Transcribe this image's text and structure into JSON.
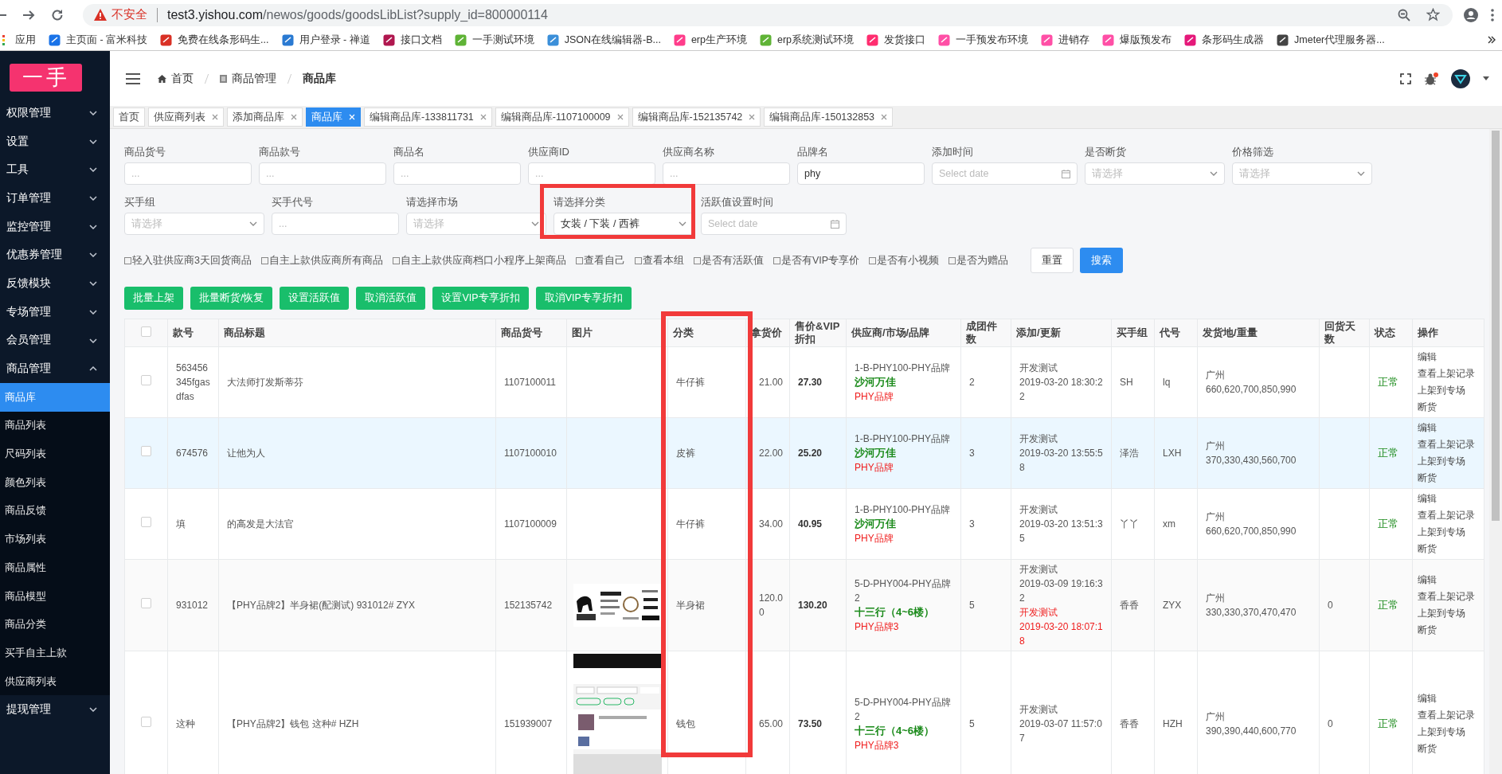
{
  "browser": {
    "security": "不安全",
    "url_host": "test3.yishou.com",
    "url_path": "/newos/goods/goodsLibList?supply_id=800000114"
  },
  "bookmarks": [
    {
      "label": "应用"
    },
    {
      "label": "主页面 - 富米科技"
    },
    {
      "label": "免费在线条形码生..."
    },
    {
      "label": "用户登录 - 禅道"
    },
    {
      "label": "接口文档"
    },
    {
      "label": "一手测试环境"
    },
    {
      "label": "JSON在线编辑器-B..."
    },
    {
      "label": "erp生产环境"
    },
    {
      "label": "erp系统测试环境"
    },
    {
      "label": "发货接口"
    },
    {
      "label": "一手预发布环境"
    },
    {
      "label": "进销存"
    },
    {
      "label": "爆版预发布"
    },
    {
      "label": "条形码生成器"
    },
    {
      "label": "Jmeter代理服务器..."
    }
  ],
  "sidebar": {
    "logo": "一手",
    "items": [
      {
        "label": "权限管理",
        "expanded": false
      },
      {
        "label": "设置",
        "expanded": false
      },
      {
        "label": "工具",
        "expanded": false
      },
      {
        "label": "订单管理",
        "expanded": false
      },
      {
        "label": "监控管理",
        "expanded": false
      },
      {
        "label": "优惠券管理",
        "expanded": false
      },
      {
        "label": "反馈模块",
        "expanded": false
      },
      {
        "label": "专场管理",
        "expanded": false
      },
      {
        "label": "会员管理",
        "expanded": false
      },
      {
        "label": "商品管理",
        "expanded": true,
        "children": [
          {
            "label": "商品库",
            "selected": true
          },
          {
            "label": "商品列表",
            "selected": false
          },
          {
            "label": "尺码列表",
            "selected": false
          },
          {
            "label": "颜色列表",
            "selected": false
          },
          {
            "label": "商品反馈",
            "selected": false
          },
          {
            "label": "市场列表",
            "selected": false
          },
          {
            "label": "商品属性",
            "selected": false
          },
          {
            "label": "商品模型",
            "selected": false
          },
          {
            "label": "商品分类",
            "selected": false
          },
          {
            "label": "买手自主上款",
            "selected": false
          },
          {
            "label": "供应商列表",
            "selected": false
          }
        ]
      },
      {
        "label": "提现管理",
        "expanded": false
      }
    ]
  },
  "breadcrumb": [
    {
      "label": "首页",
      "current": false
    },
    {
      "label": "商品管理",
      "current": false
    },
    {
      "label": "商品库",
      "current": true
    }
  ],
  "tabs": [
    {
      "label": "首页",
      "closable": false,
      "selected": false
    },
    {
      "label": "供应商列表",
      "closable": true,
      "selected": false
    },
    {
      "label": "添加商品库",
      "closable": true,
      "selected": false
    },
    {
      "label": "商品库",
      "closable": true,
      "selected": true
    },
    {
      "label": "编辑商品库-133811731",
      "closable": true,
      "selected": false
    },
    {
      "label": "编辑商品库-1107100009",
      "closable": true,
      "selected": false
    },
    {
      "label": "编辑商品库-152135742",
      "closable": true,
      "selected": false
    },
    {
      "label": "编辑商品库-150132853",
      "closable": true,
      "selected": false
    }
  ],
  "filters": {
    "rows": [
      [
        {
          "label": "商品货号",
          "kind": "input",
          "placeholder": "..."
        },
        {
          "label": "商品款号",
          "kind": "input",
          "placeholder": "..."
        },
        {
          "label": "商品名",
          "kind": "input",
          "placeholder": "..."
        },
        {
          "label": "供应商ID",
          "kind": "input",
          "placeholder": "..."
        },
        {
          "label": "供应商名称",
          "kind": "input",
          "placeholder": "..."
        },
        {
          "label": "品牌名",
          "kind": "input",
          "value": "phy"
        },
        {
          "label": "添加时间",
          "kind": "date",
          "placeholder": "Select date"
        },
        {
          "label": "是否断货",
          "kind": "select",
          "placeholder": "请选择"
        },
        {
          "label": "价格筛选",
          "kind": "select",
          "placeholder": "请选择"
        }
      ],
      [
        {
          "label": "买手组",
          "kind": "select",
          "placeholder": "请选择"
        },
        {
          "label": "买手代号",
          "kind": "input",
          "placeholder": "..."
        },
        {
          "label": "请选择市场",
          "kind": "select",
          "placeholder": "请选择"
        },
        {
          "label": "请选择分类",
          "kind": "select",
          "value": "女装 / 下装 / 西裤",
          "highlighted": true
        },
        {
          "label": "活跃值设置时间",
          "kind": "date",
          "placeholder": "Select date"
        }
      ]
    ],
    "checkboxes": [
      {
        "label": "轻入驻供应商3天回货商品",
        "checked": false
      },
      {
        "label": "自主上款供应商所有商品",
        "checked": false
      },
      {
        "label": "自主上款供应商档口小程序上架商品",
        "checked": false
      },
      {
        "label": "查看自己",
        "checked": false
      },
      {
        "label": "查看本组",
        "checked": false
      },
      {
        "label": "是否有活跃值",
        "checked": false
      },
      {
        "label": "是否有VIP专享价",
        "checked": false
      },
      {
        "label": "是否有小视频",
        "checked": false
      },
      {
        "label": "是否为赠品",
        "checked": false
      }
    ],
    "reset": "重置",
    "search": "搜索"
  },
  "actions": [
    "批量上架",
    "批量断货/恢复",
    "设置活跃值",
    "取消活跃值",
    "设置VIP专享折扣",
    "取消VIP专享折扣"
  ],
  "table": {
    "select_all": {
      "checked": false
    },
    "columns": [
      {
        "label": "款号",
        "highlighted": false
      },
      {
        "label": "商品标题",
        "highlighted": false
      },
      {
        "label": "商品货号",
        "highlighted": false
      },
      {
        "label": "图片",
        "highlighted": false
      },
      {
        "label": "分类",
        "highlighted": true
      },
      {
        "label": "拿货价",
        "highlighted": false
      },
      {
        "label": "售价&VIP折扣",
        "highlighted": false
      },
      {
        "label": "供应商/市场/品牌",
        "highlighted": false
      },
      {
        "label": "成团件数",
        "highlighted": false
      },
      {
        "label": "添加/更新",
        "highlighted": false
      },
      {
        "label": "买手组",
        "highlighted": false
      },
      {
        "label": "代号",
        "highlighted": false
      },
      {
        "label": "发货地/重量",
        "highlighted": false
      },
      {
        "label": "回货天数",
        "highlighted": false
      },
      {
        "label": "状态",
        "highlighted": false
      },
      {
        "label": "操作",
        "highlighted": false
      }
    ],
    "rows": [
      {
        "checked": false,
        "highlighted": false,
        "style_no": "563456345fgasdfas",
        "title": "大法师打发斯蒂芬",
        "sku": "1107100011",
        "category": "牛仔裤",
        "cost": "21.00",
        "price": "27.30",
        "supplier": "1-B-PHY100-PHY品牌",
        "market": "沙河万佳",
        "brand": "PHY品牌",
        "group_size": "2",
        "added_by": "开发测试",
        "added_at": "2019-03-20 18:30:22",
        "buyer_group": "SH",
        "code": "lq",
        "origin": "广州",
        "weights": "660,620,700,850,990",
        "status": "正常",
        "actions": [
          "编辑",
          "查看上架记录",
          "上架到专场",
          "断货"
        ]
      },
      {
        "checked": false,
        "highlighted": true,
        "style_no": "674576",
        "title": "让他为人",
        "sku": "1107100010",
        "category": "皮裤",
        "cost": "22.00",
        "price": "25.20",
        "supplier": "1-B-PHY100-PHY品牌",
        "market": "沙河万佳",
        "brand": "PHY品牌",
        "group_size": "3",
        "added_by": "开发测试",
        "added_at": "2019-03-20 13:55:58",
        "buyer_group": "泽浩",
        "code": "LXH",
        "origin": "广州",
        "weights": "370,330,430,560,700",
        "status": "正常",
        "actions": [
          "编辑",
          "查看上架记录",
          "上架到专场",
          "断货"
        ]
      },
      {
        "checked": false,
        "highlighted": false,
        "style_no": "填",
        "title": "的高发是大法官",
        "sku": "1107100009",
        "category": "牛仔裤",
        "cost": "34.00",
        "price": "40.95",
        "supplier": "1-B-PHY100-PHY品牌",
        "market": "沙河万佳",
        "brand": "PHY品牌",
        "group_size": "3",
        "added_by": "开发测试",
        "added_at": "2019-03-20 13:51:35",
        "buyer_group": "丫丫",
        "code": "xm",
        "origin": "广州",
        "weights": "660,620,700,850,990",
        "status": "正常",
        "actions": [
          "编辑",
          "查看上架记录",
          "上架到专场",
          "断货"
        ]
      },
      {
        "checked": false,
        "highlighted": false,
        "style_no": "931012",
        "title": "【PHY品牌2】半身裙(配测试) 931012# ZYX",
        "sku": "152135742",
        "image": {
          "kind": "picture"
        },
        "category": "半身裙",
        "cost": "120.00",
        "price": "130.20",
        "supplier": "5-D-PHY004-PHY品牌2",
        "market": "十三行（4~6楼）",
        "brand": "PHY品牌3",
        "group_size": "5",
        "added_by": "开发测试",
        "added_at": "2019-03-09 19:16:32",
        "updated_by": "开发测试",
        "updated_at": "2019-03-20 18:07:18",
        "buyer_group": "香香",
        "code": "ZYX",
        "origin": "广州",
        "weights": "330,330,370,470,470",
        "return_days": "0",
        "status": "正常",
        "actions": [
          "编辑",
          "查看上架记录",
          "上架到专场",
          "断货"
        ]
      },
      {
        "checked": false,
        "highlighted": false,
        "style_no": "这种",
        "title": "【PHY品牌2】钱包 这种# HZH",
        "sku": "151939007",
        "image": {
          "kind": "picture"
        },
        "category": "钱包",
        "cost": "65.00",
        "price": "73.50",
        "supplier": "5-D-PHY004-PHY品牌2",
        "market": "十三行（4~6楼）",
        "brand": "PHY品牌3",
        "group_size": "5",
        "added_by": "开发测试",
        "added_at": "2019-03-07 11:57:07",
        "buyer_group": "香香",
        "code": "HZH",
        "origin": "广州",
        "weights": "390,390,440,600,770",
        "return_days": "0",
        "status": "正常",
        "actions": [
          "编辑",
          "查看上架记录",
          "上架到专场",
          "断货"
        ]
      }
    ]
  }
}
